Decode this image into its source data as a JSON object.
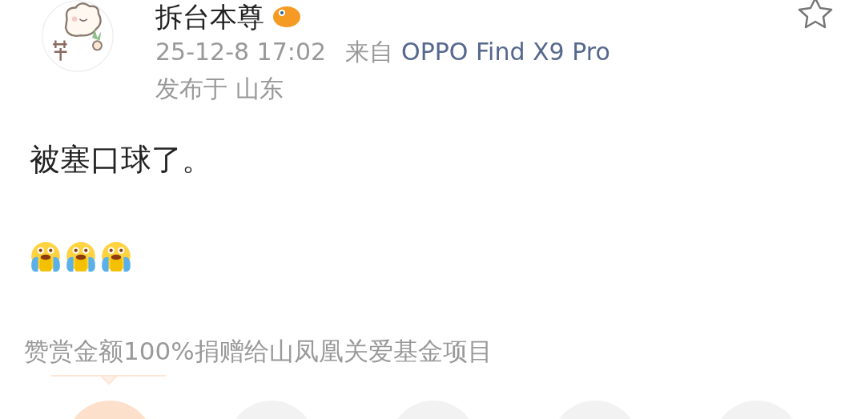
{
  "author": {
    "name": "拆台本尊"
  },
  "meta": {
    "time": "25-12-8 17:02",
    "source_label": "来自",
    "device": "OPPO Find X9 Pro",
    "location": "发布于 山东"
  },
  "post": {
    "text": "被塞口球了。",
    "emojis": [
      {
        "kind": "crying"
      },
      {
        "kind": "crying"
      },
      {
        "kind": "crying"
      }
    ]
  },
  "reward": {
    "caption": "赞赏金额100%捐赠给山凤凰关爱基金项目",
    "options": [
      {
        "selected": true
      },
      {
        "selected": false
      },
      {
        "selected": false
      },
      {
        "selected": false
      },
      {
        "selected": false
      }
    ]
  },
  "favorite": {
    "selected": false
  }
}
